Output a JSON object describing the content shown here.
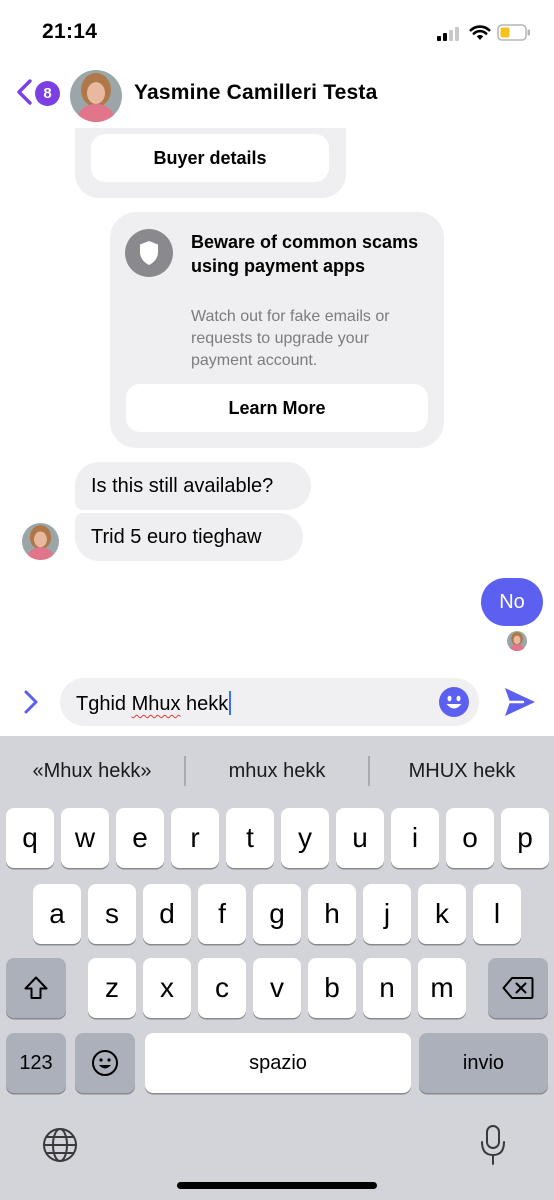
{
  "status_bar": {
    "time": "21:14"
  },
  "header": {
    "unread_count": "8",
    "contact_name": "Yasmine Camilleri Testa"
  },
  "cards": {
    "buyer_details_label": "Buyer details",
    "scam_title": "Beware of common scams using payment apps",
    "scam_body": "Watch out for fake emails or requests to upgrade your payment account.",
    "learn_more_label": "Learn More"
  },
  "messages": [
    {
      "direction": "incoming",
      "text": "Is this still available?"
    },
    {
      "direction": "incoming",
      "text": "Trid 5 euro tieghaw"
    },
    {
      "direction": "outgoing",
      "text": "No"
    }
  ],
  "composer": {
    "text_plain": "Tghid ",
    "text_misspelled": "Mhux",
    "text_rest": " hekk"
  },
  "keyboard": {
    "predictions": [
      "«Mhux hekk»",
      "mhux hekk",
      "MHUX hekk"
    ],
    "row1": [
      "q",
      "w",
      "e",
      "r",
      "t",
      "y",
      "u",
      "i",
      "o",
      "p"
    ],
    "row2": [
      "a",
      "s",
      "d",
      "f",
      "g",
      "h",
      "j",
      "k",
      "l"
    ],
    "row3": [
      "z",
      "x",
      "c",
      "v",
      "b",
      "n",
      "m"
    ],
    "numbers_label": "123",
    "space_label": "spazio",
    "return_label": "invio"
  },
  "colors": {
    "accent": "#5b60f0",
    "badge": "#7b3fe4",
    "incoming_bubble": "#efeff1",
    "keyboard_bg": "#d2d4da"
  },
  "icons": [
    "back-chevron-icon",
    "shield-icon",
    "expand-chevron-icon",
    "emoji-icon",
    "send-icon",
    "shift-icon",
    "backspace-icon",
    "emoji-keyboard-icon",
    "globe-icon",
    "microphone-icon"
  ]
}
